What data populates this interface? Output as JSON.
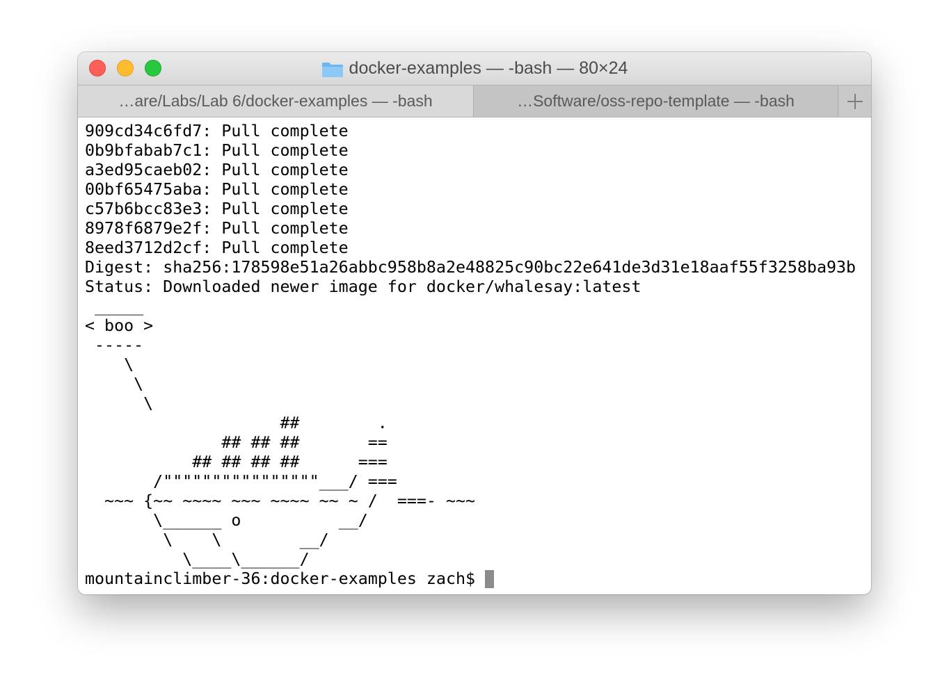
{
  "window": {
    "title": "docker-examples — -bash — 80×24"
  },
  "tabs": [
    {
      "label": "…are/Labs/Lab 6/docker-examples — -bash"
    },
    {
      "label": "…Software/oss-repo-template — -bash"
    }
  ],
  "terminal": {
    "lines": [
      "909cd34c6fd7: Pull complete",
      "0b9bfabab7c1: Pull complete",
      "a3ed95caeb02: Pull complete",
      "00bf65475aba: Pull complete",
      "c57b6bcc83e3: Pull complete",
      "8978f6879e2f: Pull complete",
      "8eed3712d2cf: Pull complete",
      "Digest: sha256:178598e51a26abbc958b8a2e48825c90bc22e641de3d31e18aaf55f3258ba93b",
      "Status: Downloaded newer image for docker/whalesay:latest",
      " _____",
      "< boo >",
      " -----",
      "    \\",
      "     \\",
      "      \\",
      "                    ##        .",
      "              ## ## ##       ==",
      "           ## ## ## ##      ===",
      "       /\"\"\"\"\"\"\"\"\"\"\"\"\"\"\"\"___/ ===",
      "  ~~~ {~~ ~~~~ ~~~ ~~~~ ~~ ~ /  ===- ~~~",
      "       \\______ o          __/",
      "        \\    \\        __/",
      "          \\____\\______/"
    ],
    "prompt": "mountainclimber-36:docker-examples zach$ "
  }
}
